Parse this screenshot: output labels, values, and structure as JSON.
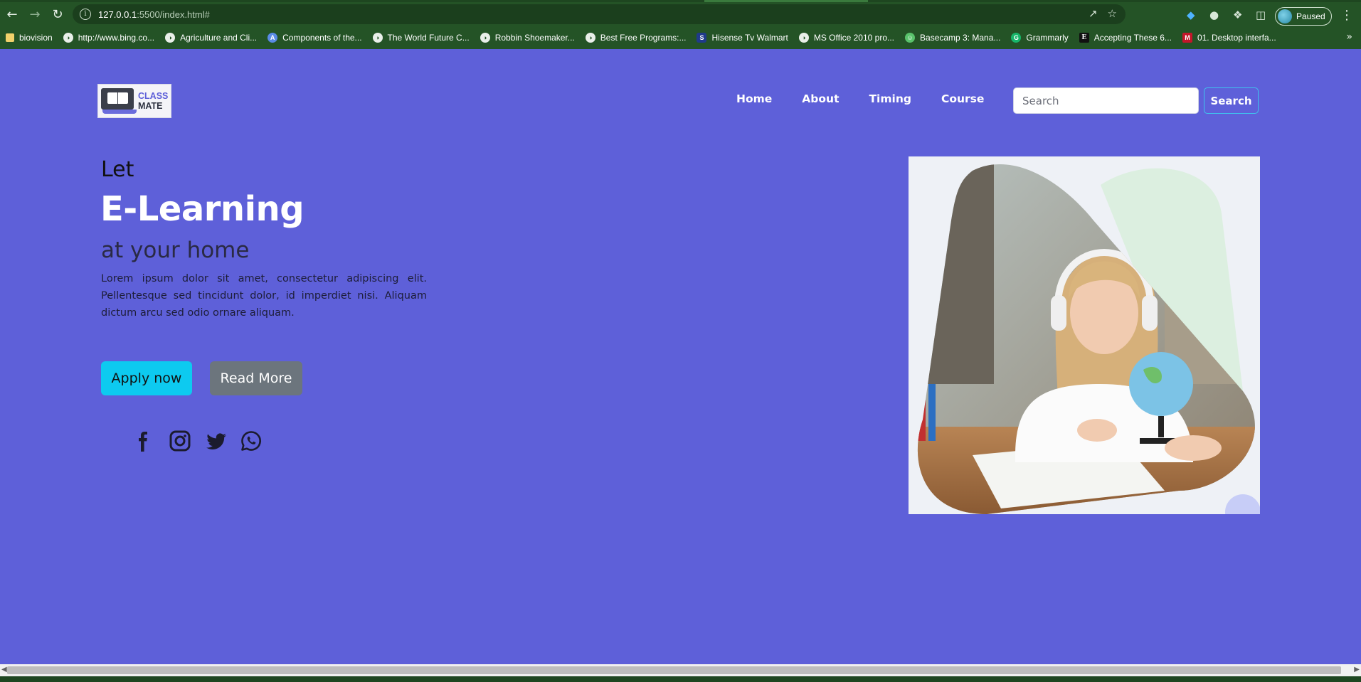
{
  "browser": {
    "url_host": "127.0.0.1",
    "url_rest": ":5500/index.html#",
    "profile_label": "Paused",
    "bookmarks": [
      {
        "label": "biovision",
        "icon": "folder-icon"
      },
      {
        "label": "http://www.bing.co...",
        "icon": "globe-icon"
      },
      {
        "label": "Agriculture and Cli...",
        "icon": "globe-icon"
      },
      {
        "label": "Components of the...",
        "icon": "a-icon"
      },
      {
        "label": "The World Future C...",
        "icon": "globe-icon"
      },
      {
        "label": "Robbin Shoemaker...",
        "icon": "globe-icon"
      },
      {
        "label": "Best Free Programs:...",
        "icon": "globe-icon"
      },
      {
        "label": "Hisense Tv Walmart",
        "icon": "s-icon"
      },
      {
        "label": "MS Office 2010 pro...",
        "icon": "globe-icon"
      },
      {
        "label": "Basecamp 3: Mana...",
        "icon": "basecamp-icon"
      },
      {
        "label": "Grammarly",
        "icon": "grammarly-icon"
      },
      {
        "label": "Accepting These 6...",
        "icon": "e-icon"
      },
      {
        "label": "01. Desktop interfa...",
        "icon": "m-icon"
      }
    ]
  },
  "site": {
    "logo": {
      "line1": "CLASS",
      "line2": "MATE"
    },
    "nav": [
      "Home",
      "About",
      "Timing",
      "Course"
    ],
    "search": {
      "placeholder": "Search",
      "button": "Search"
    }
  },
  "hero": {
    "kicker": "Let",
    "title": "E-Learning",
    "subtitle": "at your home",
    "paragraph": "Lorem ipsum dolor sit amet, consectetur adipiscing elit. Pellentesque sed tincidunt dolor, id imperdiet nisi. Aliquam dictum arcu sed odio ornare aliquam.",
    "apply_label": "Apply now",
    "read_label": "Read More",
    "social": [
      "facebook-icon",
      "instagram-icon",
      "twitter-icon",
      "whatsapp-icon"
    ],
    "image": "girl-with-headphones-and-globe"
  },
  "colors": {
    "page_bg": "#5e60d9",
    "chrome_bg": "#245326",
    "apply_bg": "#0dcaf0",
    "read_bg": "#6c757d"
  }
}
